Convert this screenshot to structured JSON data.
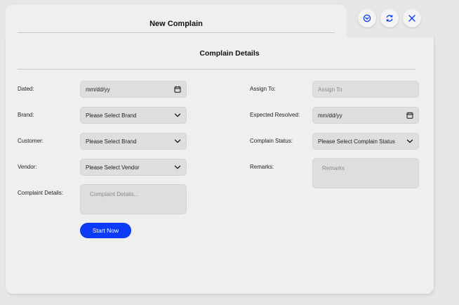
{
  "header": {
    "title": "New Complain"
  },
  "section": {
    "title": "Complain Details"
  },
  "left": {
    "dated": {
      "label": "Dated:",
      "value": "mm/dd/yy"
    },
    "brand": {
      "label": "Brand:",
      "value": "Please Select Brand"
    },
    "customer": {
      "label": "Customer:",
      "value": "Please Select Brand"
    },
    "vendor": {
      "label": "Vendor:",
      "value": "Please Select Vendor"
    },
    "details": {
      "label": "Complaint Details:",
      "placeholder": "Complaint Details..."
    }
  },
  "right": {
    "assign": {
      "label": "Assign To:",
      "placeholder": "Assign To"
    },
    "expected": {
      "label": "Expected Resolved:",
      "value": "mm/dd/yy"
    },
    "status": {
      "label": "Complain Status:",
      "value": "Please Select Complain Status"
    },
    "remarks": {
      "label": "Remarks:",
      "placeholder": "Remarks"
    }
  },
  "actions": {
    "start_label": "Start Now"
  },
  "icons": {
    "collapse": "chevron-circle-icon",
    "refresh": "refresh-icon",
    "close": "close-icon"
  },
  "colors": {
    "accent": "#0b3bf5",
    "panel": "#efefef",
    "field": "#dedede"
  }
}
